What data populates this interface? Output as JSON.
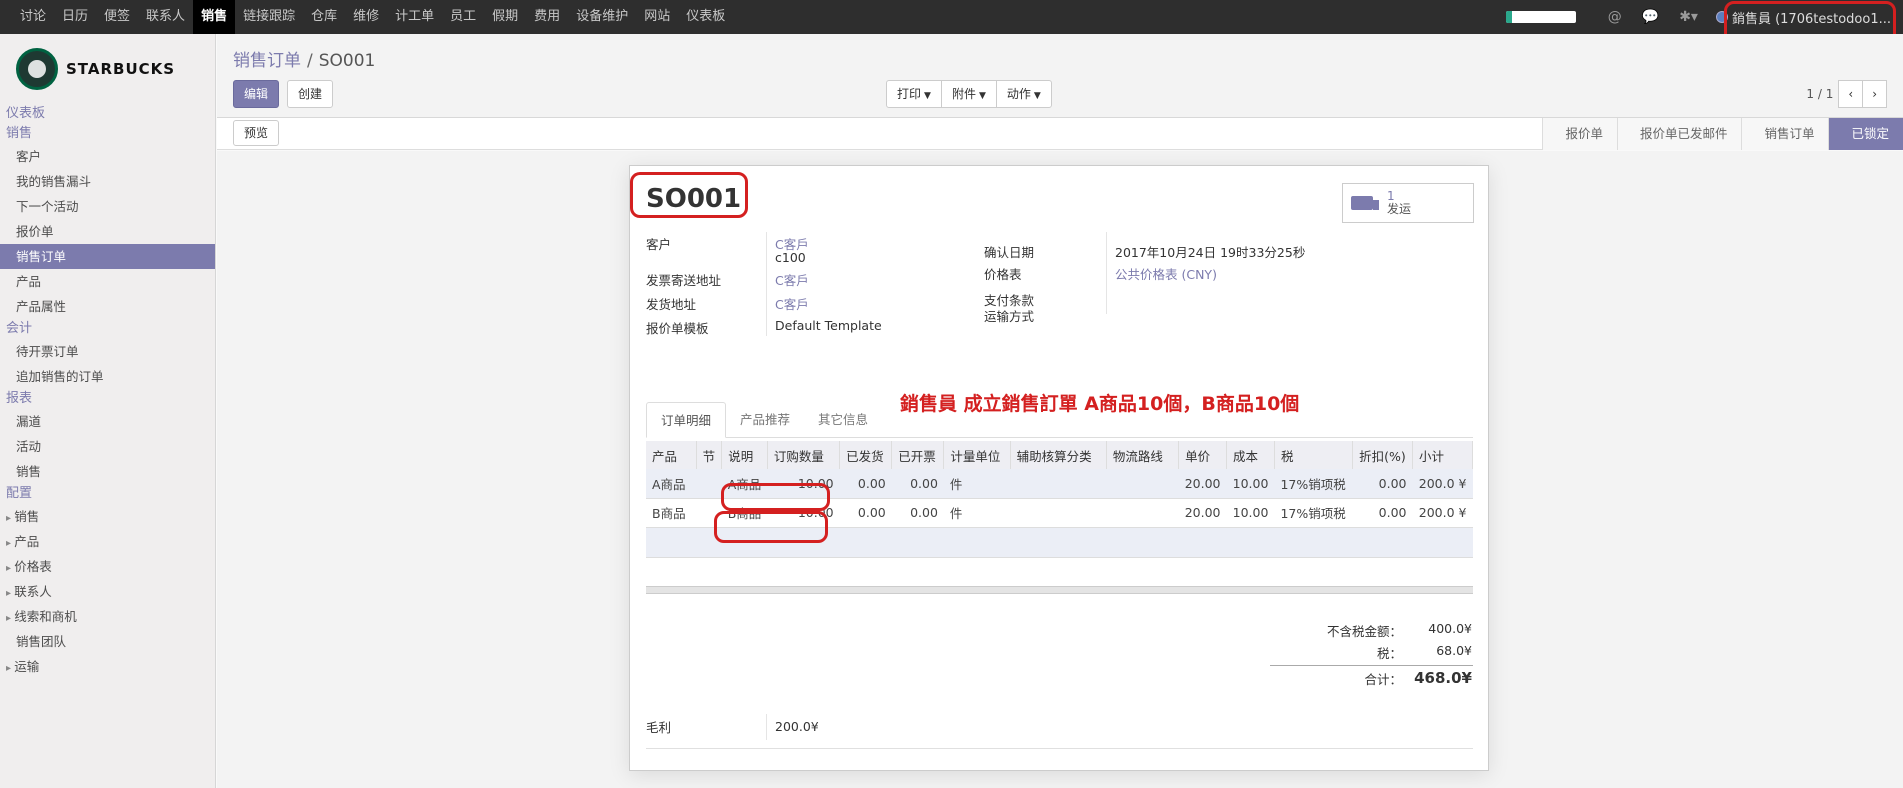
{
  "topnav": {
    "items": [
      "讨论",
      "日历",
      "便签",
      "联系人",
      "销售",
      "链接跟踪",
      "仓库",
      "维修",
      "计工单",
      "员工",
      "假期",
      "费用",
      "设备维护",
      "网站",
      "仪表板"
    ],
    "active_index": 4,
    "user": "銷售員 (1706testodoo1...",
    "icons": [
      "at-icon",
      "chat-icon",
      "bug-icon"
    ]
  },
  "sidebar": {
    "logo_text": "STARBUCKS",
    "sections": [
      {
        "title": "仪表板",
        "items": []
      },
      {
        "title": "销售",
        "items": [
          "客户",
          "我的销售漏斗",
          "下一个活动",
          "报价单",
          "销售订单",
          "产品",
          "产品属性"
        ]
      },
      {
        "title": "会计",
        "items": [
          "待开票订单",
          "追加销售的订单"
        ]
      },
      {
        "title": "报表",
        "items": [
          "漏道",
          "活动",
          "销售"
        ]
      },
      {
        "title": "配置",
        "items": [
          "销售",
          "产品",
          "价格表",
          "联系人",
          "线索和商机",
          "销售团队",
          "运输"
        ]
      }
    ],
    "active_item": "销售订单"
  },
  "control": {
    "breadcrumb_parent": "销售订单",
    "breadcrumb_sep": "/",
    "breadcrumb_current": "SO001",
    "edit_label": "编辑",
    "create_label": "创建",
    "print_label": "打印",
    "attach_label": "附件",
    "action_label": "动作",
    "pager_text": "1 / 1"
  },
  "statusbar": {
    "preview_label": "预览",
    "stages": [
      "报价单",
      "报价单已发邮件",
      "销售订单",
      "已锁定"
    ],
    "current_stage": "已锁定"
  },
  "form": {
    "name": "SO001",
    "delivery_count": "1",
    "delivery_label": "发运",
    "customer_label": "客户",
    "customer_value": "C客戶",
    "customer_ref": "c100",
    "invoice_addr_label": "发票寄送地址",
    "invoice_addr_value": "C客戶",
    "ship_addr_label": "发货地址",
    "ship_addr_value": "C客戶",
    "template_label": "报价单模板",
    "template_value": "Default Template",
    "confirm_date_label": "确认日期",
    "confirm_date_value": "2017年10月24日 19时33分25秒",
    "pricelist_label": "价格表",
    "pricelist_value": "公共价格表 (CNY)",
    "payment_terms_label": "支付条款",
    "shipping_label": "运输方式",
    "annotation": "銷售員 成立銷售訂單  A商品10個，B商品10個",
    "tabs": [
      "订单明细",
      "产品推荐",
      "其它信息"
    ],
    "columns": [
      "产品",
      "节",
      "说明",
      "订购数量",
      "已发货",
      "已开票",
      "计量单位",
      "辅助核算分类",
      "物流路线",
      "单价",
      "成本",
      "税",
      "折扣(%)",
      "小计"
    ],
    "lines": [
      {
        "product": "A商品",
        "section": "",
        "desc": "A商品",
        "qty": "10.00",
        "delivered": "0.00",
        "invoiced": "0.00",
        "uom": "件",
        "analytic": "",
        "route": "",
        "price": "20.00",
        "cost": "10.00",
        "tax": "17%销项税",
        "discount": "0.00",
        "subtotal": "200.0 ¥"
      },
      {
        "product": "B商品",
        "section": "",
        "desc": "B商品",
        "qty": "10.00",
        "delivered": "0.00",
        "invoiced": "0.00",
        "uom": "件",
        "analytic": "",
        "route": "",
        "price": "20.00",
        "cost": "10.00",
        "tax": "17%销项税",
        "discount": "0.00",
        "subtotal": "200.0 ¥"
      }
    ],
    "untaxed_label": "不含税金额：",
    "untaxed_value": "400.0¥",
    "tax_label": "税：",
    "tax_value": "68.0¥",
    "total_label": "合计：",
    "total_value": "468.0¥",
    "margin_label": "毛利",
    "margin_value": "200.0¥"
  },
  "colors": {
    "accent": "#7c7bad",
    "annotation": "#d42020",
    "navbar": "#2e2e2e"
  }
}
